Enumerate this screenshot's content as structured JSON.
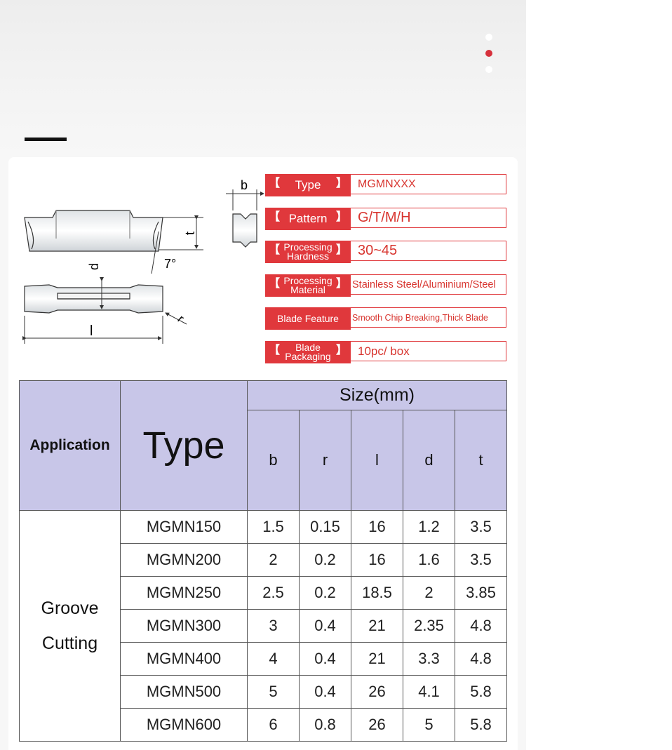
{
  "carousel": {
    "dots": 3,
    "active_index": 1
  },
  "diagram": {
    "labels": {
      "b": "b",
      "t": "t",
      "angle": "7°",
      "d": "d",
      "r": "r",
      "l": "l"
    }
  },
  "specs": [
    {
      "label": "Type",
      "value": "MGMNXXX"
    },
    {
      "label": "Pattern",
      "value": "G/T/M/H"
    },
    {
      "label": "Processing Hardness",
      "line1": "Processing",
      "line2": "Hardness",
      "value": "30~45"
    },
    {
      "label": "Processing Material",
      "line1": "Processing",
      "line2": "Material",
      "value": "Stainless Steel/Aluminium/Steel"
    },
    {
      "label": "Blade Feature",
      "value": "Smooth Chip Breaking,Thick Blade"
    },
    {
      "label": "Blade Packaging",
      "line1": "Blade",
      "line2": "Packaging",
      "value": "10pc/ box"
    }
  ],
  "table": {
    "application_header": "Application",
    "type_header": "Type",
    "size_header": "Size(mm)",
    "dim_headers": [
      "b",
      "r",
      "l",
      "d",
      "t"
    ],
    "application_line1": "Groove",
    "application_line2": "Cutting",
    "rows": [
      {
        "type": "MGMN150",
        "b": "1.5",
        "r": "0.15",
        "l": "16",
        "d": "1.2",
        "t": "3.5"
      },
      {
        "type": "MGMN200",
        "b": "2",
        "r": "0.2",
        "l": "16",
        "d": "1.6",
        "t": "3.5"
      },
      {
        "type": "MGMN250",
        "b": "2.5",
        "r": "0.2",
        "l": "18.5",
        "d": "2",
        "t": "3.85"
      },
      {
        "type": "MGMN300",
        "b": "3",
        "r": "0.4",
        "l": "21",
        "d": "2.35",
        "t": "4.8"
      },
      {
        "type": "MGMN400",
        "b": "4",
        "r": "0.4",
        "l": "21",
        "d": "3.3",
        "t": "4.8"
      },
      {
        "type": "MGMN500",
        "b": "5",
        "r": "0.4",
        "l": "26",
        "d": "4.1",
        "t": "5.8"
      },
      {
        "type": "MGMN600",
        "b": "6",
        "r": "0.8",
        "l": "26",
        "d": "5",
        "t": "5.8"
      }
    ]
  },
  "colors": {
    "accent": "#e0383c",
    "header_bg": "#c8c6e8",
    "active_dot": "#d6303b"
  }
}
